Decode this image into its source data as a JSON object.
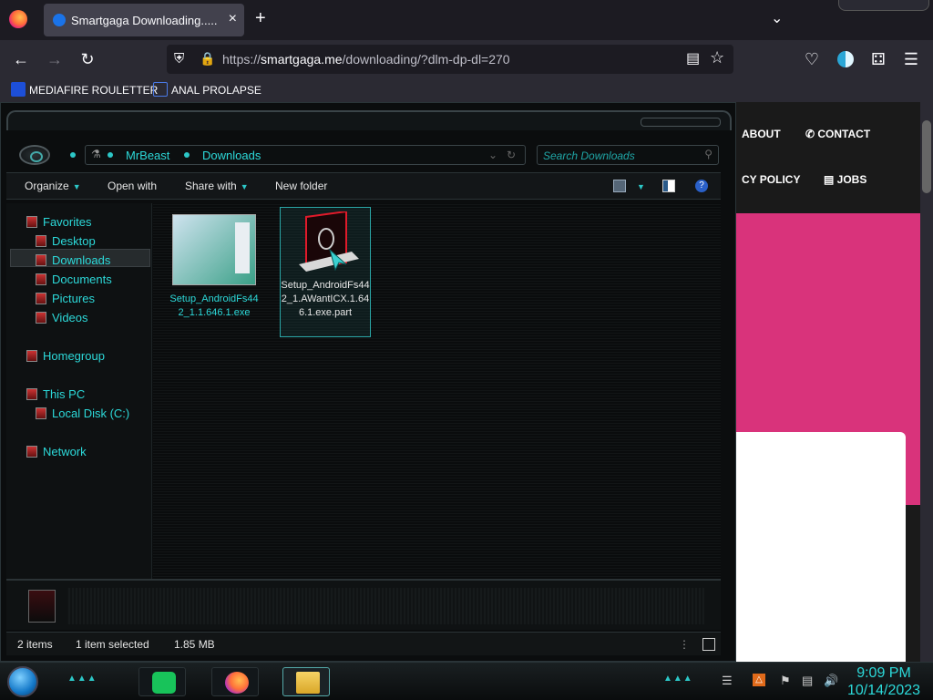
{
  "browser": {
    "tab_title": "Smartgaga Downloading..... | Sm",
    "close_tab_glyph": "×",
    "new_tab_glyph": "+",
    "url_host_prefix": "https://",
    "url_domain": "smartgaga.me",
    "url_path": "/downloading/?dlm-dp-dl=270",
    "bookmarks": [
      {
        "label": "MEDIAFIRE ROULETTER",
        "icon": "mediafire-icon"
      },
      {
        "label": "ANAL PROLAPSE",
        "icon": "bookmark-icon"
      }
    ]
  },
  "website": {
    "menu": [
      "ABOUT",
      "CONTACT",
      "CY POLICY",
      "JOBS"
    ],
    "accent_color": "#d9337b"
  },
  "explorer": {
    "breadcrumbs": [
      "MrBeast",
      "Downloads"
    ],
    "search_placeholder": "Search Downloads",
    "toolbar": {
      "organize": "Organize",
      "open_with": "Open with",
      "share_with": "Share with",
      "new_folder": "New folder"
    },
    "nav": {
      "favorites": "Favorites",
      "desktop": "Desktop",
      "downloads": "Downloads",
      "documents": "Documents",
      "pictures": "Pictures",
      "videos": "Videos",
      "homegroup": "Homegroup",
      "this_pc": "This PC",
      "local_disk": "Local Disk (C:)",
      "network": "Network"
    },
    "files": [
      {
        "name": "Setup_AndroidFs442_1.1.646.1.exe",
        "selected": false
      },
      {
        "name": "Setup_AndroidFs442_1.AWantICX.1.646.1.exe.part",
        "selected": true
      }
    ],
    "status": {
      "item_count": "2 items",
      "selection": "1 item selected",
      "size": "1.85 MB"
    },
    "accent_color": "#2cd9d9"
  },
  "taskbar": {
    "time": "9:09 PM",
    "date": "10/14/2023",
    "apps": [
      "notes-app-icon",
      "firefox-icon",
      "file-explorer-icon"
    ]
  }
}
